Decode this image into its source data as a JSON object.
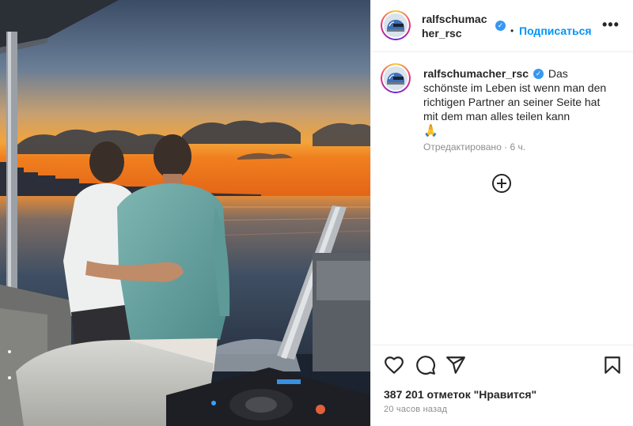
{
  "post": {
    "username_line1": "ralfschumac",
    "username_line2": "her_rsc",
    "username": "ralfschumacher_rsc",
    "verified_mark": "✓",
    "dot": "•",
    "follow_label": "Подписаться",
    "more_label": "•••",
    "caption_text": "Das schönste im Leben ist wenn man den richtigen Partner an seiner Seite hat mit dem man alles teilen kann",
    "caption_emoji": "🙏",
    "edited_label": "Отредактировано",
    "edited_time": "6 ч.",
    "meta_separator": "·",
    "likes_text": "387 201 отметок \"Нравится\"",
    "posted_time": "20 часов назад"
  },
  "icons": {
    "verified": "verified-badge-icon",
    "more": "more-options-icon",
    "load_more": "plus-circle-icon",
    "like": "heart-icon",
    "comment": "comment-icon",
    "share": "paper-plane-icon",
    "save": "bookmark-icon"
  },
  "colors": {
    "accent": "#0095f6",
    "verified": "#3897f0",
    "text": "#262626",
    "muted": "#8e8e8e",
    "border": "#efefef"
  }
}
